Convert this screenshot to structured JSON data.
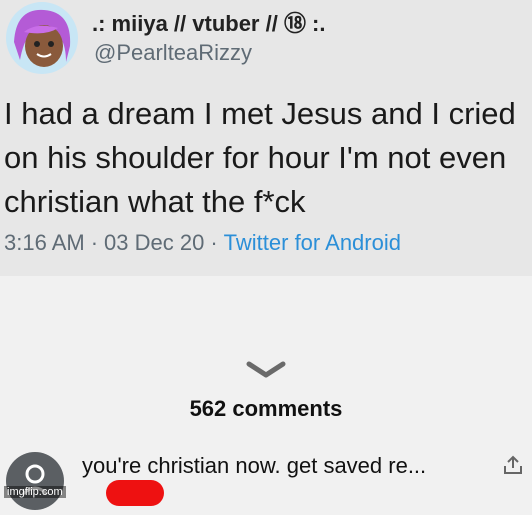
{
  "tweet": {
    "display_name": ".: miiya // vtuber // ⑱ :.",
    "handle": "@PearlteaRizzy",
    "text": "I had a dream I met Jesus and I cried on his shoulder for hour I'm not even christian what the f*ck",
    "time": "3:16 AM",
    "date": "03 Dec 20",
    "client": "Twitter for Android",
    "separator": "·"
  },
  "comments": {
    "count_label": "562 comments",
    "first": {
      "text": "you're christian now. get saved re..."
    }
  },
  "watermark": "imgflip.com",
  "colors": {
    "link": "#2b8fd8",
    "tweet_bg": "#e7e7e7",
    "page_bg": "#f1f1f1"
  }
}
